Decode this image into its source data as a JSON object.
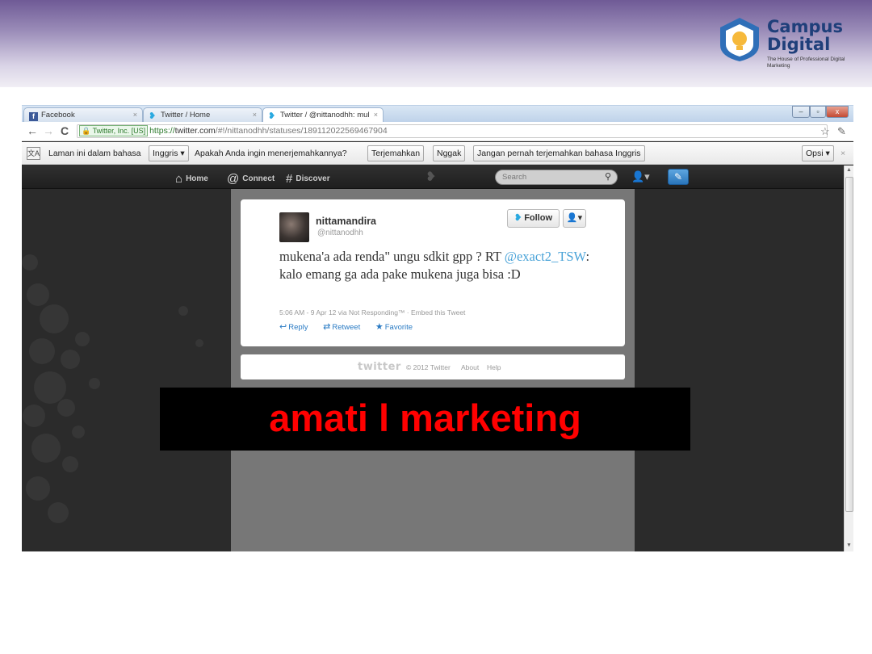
{
  "logo": {
    "line1": "Campus",
    "line2": "Digital",
    "tagline": "The House of Professional Digital Marketing"
  },
  "browser": {
    "tabs": [
      {
        "label": "Facebook",
        "icon": "facebook-icon"
      },
      {
        "label": "Twitter / Home",
        "icon": "twitter-bird-icon"
      },
      {
        "label": "Twitter / @nittanodhh: mul",
        "icon": "twitter-bird-icon"
      }
    ],
    "address": {
      "ev_badge": "Twitter, Inc. [US]",
      "protocol": "https://",
      "host": "twitter.com",
      "path": "/#!/nittanodhh/statuses/189112022569467904"
    },
    "translate_bar": {
      "prompt_start": "Laman ini dalam bahasa",
      "language_select": "Inggris",
      "question": "Apakah Anda ingin menerjemahkannya?",
      "translate_button": "Terjemahkan",
      "no_button": "Nggak",
      "never_button": "Jangan pernah terjemahkan bahasa Inggris",
      "options_button": "Opsi"
    }
  },
  "twitter": {
    "nav": {
      "home": "Home",
      "connect": "Connect",
      "discover": "Discover",
      "search_placeholder": "Search"
    },
    "tweet": {
      "name": "nittamandira",
      "handle": "@nittanodhh",
      "follow_label": "Follow",
      "text_part1": "mukena'a ada renda\" ungu sdkit gpp ? RT",
      "mention": "@exact2_TSW",
      "text_part2": ": kalo emang ga ada pake mukena juga bisa :D",
      "meta": "5:06 AM - 9 Apr 12 via Not Responding™ · Embed this Tweet",
      "reply": "Reply",
      "retweet": "Retweet",
      "favorite": "Favorite"
    },
    "footer": {
      "logo_text": "twitter",
      "copyright": "© 2012 Twitter",
      "about": "About",
      "help": "Help"
    }
  },
  "caption": {
    "text": "amati l marketing",
    "color": "#ff0000"
  }
}
